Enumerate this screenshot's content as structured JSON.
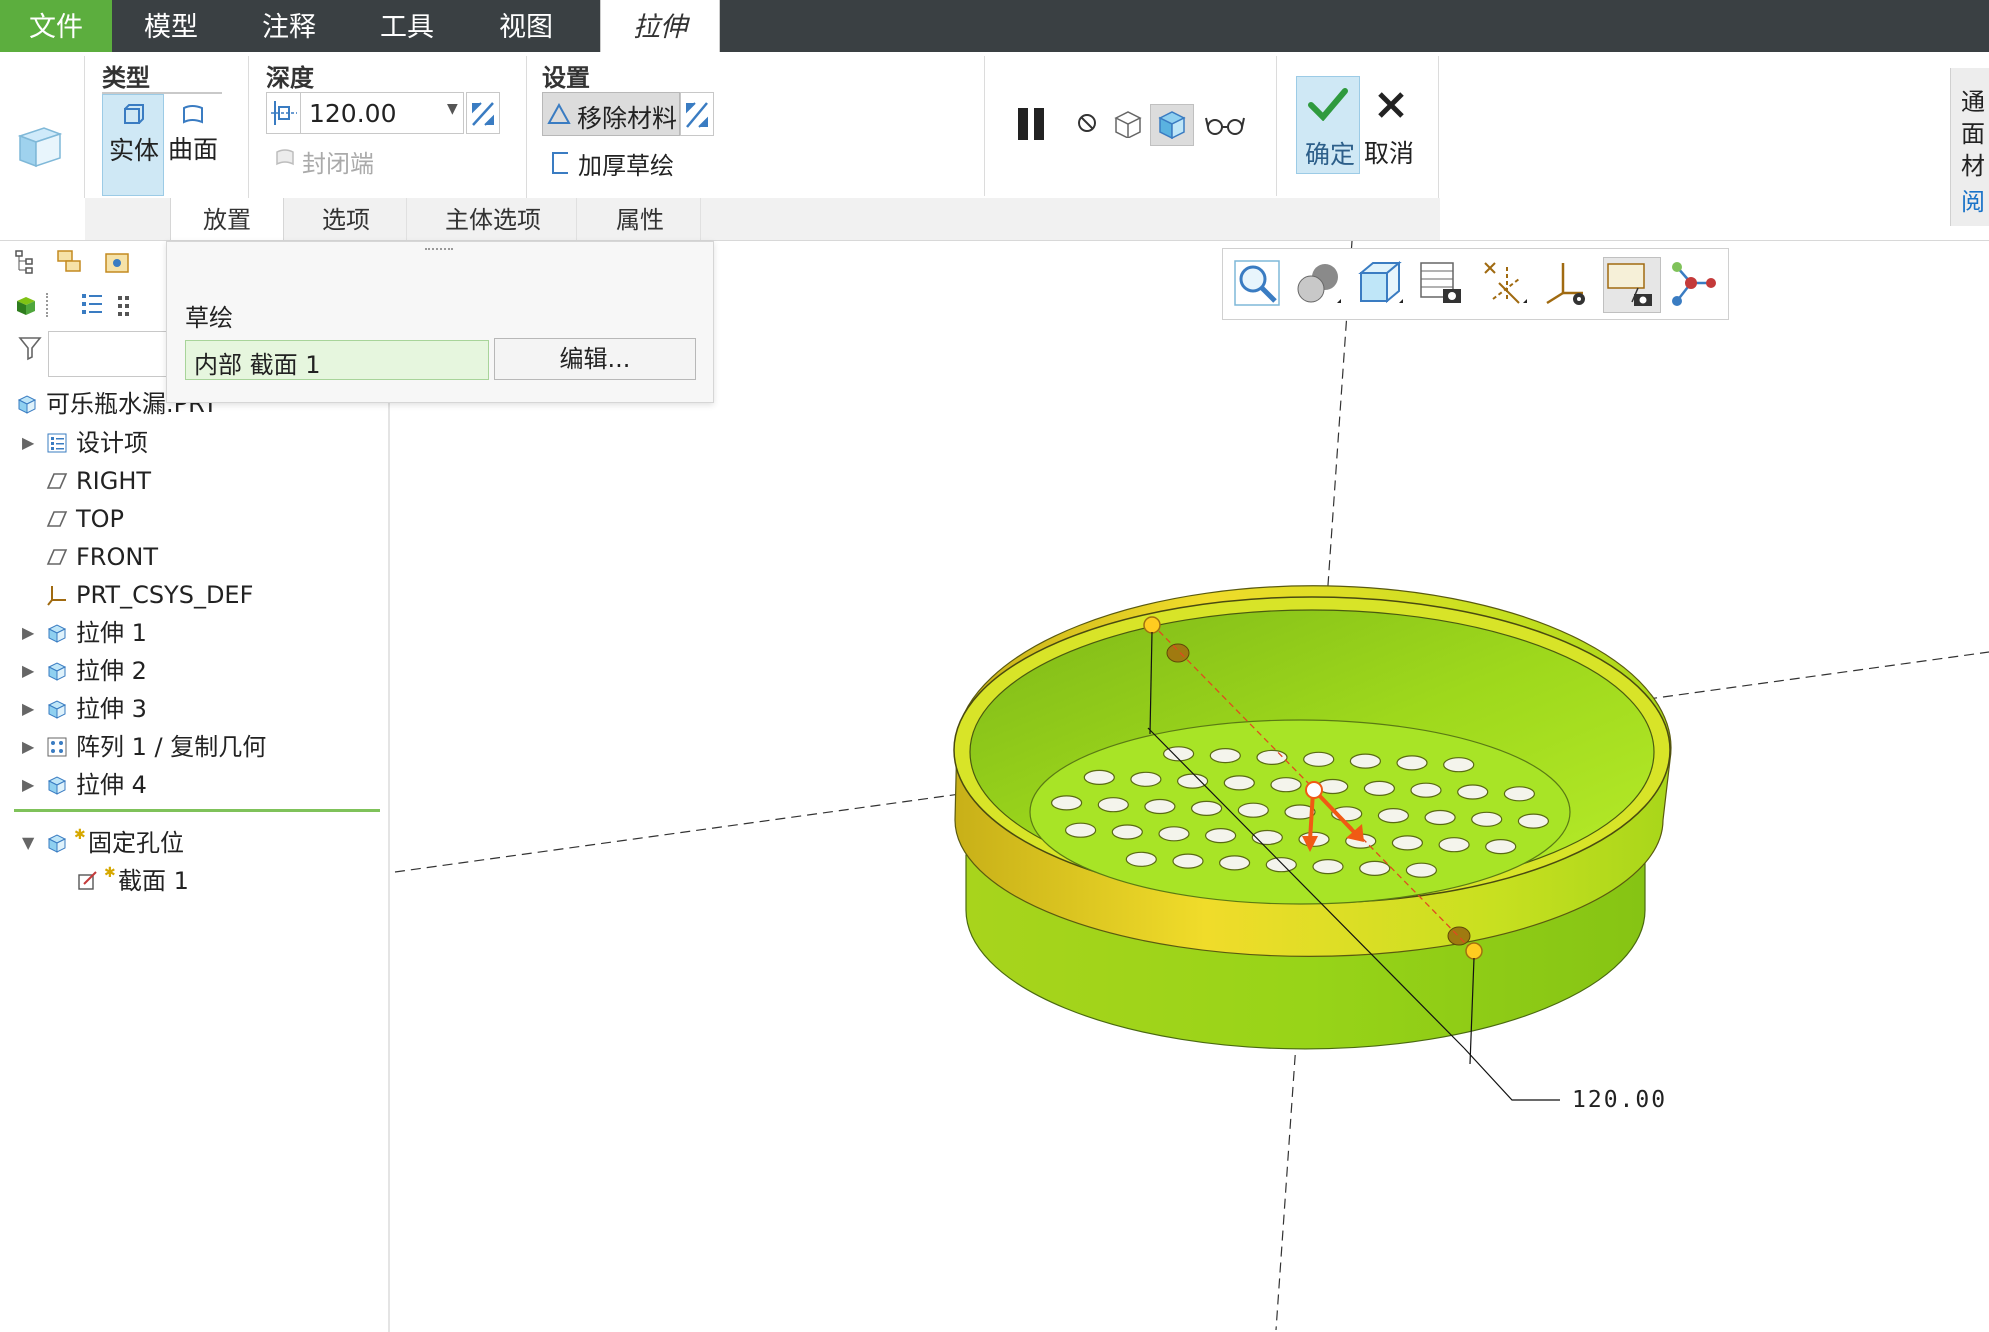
{
  "menubar": {
    "items": [
      "文件",
      "模型",
      "注释",
      "工具",
      "视图",
      "拉伸"
    ]
  },
  "ribbon": {
    "type_group": {
      "title": "类型",
      "solid": "实体",
      "surface": "曲面"
    },
    "depth_group": {
      "title": "深度",
      "value": "120.00",
      "capped_ends": "封闭端"
    },
    "settings_group": {
      "title": "设置",
      "remove_material": "移除材料",
      "thicken_sketch": "加厚草绘"
    },
    "ok_label": "确定",
    "cancel_label": "取消",
    "right_side": {
      "line1": "通",
      "line2": "面",
      "line3": "材",
      "link": "阅"
    }
  },
  "subtabs": [
    "放置",
    "选项",
    "主体选项",
    "属性"
  ],
  "placement_panel": {
    "sketch_label": "草绘",
    "sketch_value": "内部 截面 1",
    "edit_button": "编辑..."
  },
  "tree": {
    "root": "可乐瓶水漏.PRT",
    "items": [
      {
        "label": "设计项",
        "expandable": true,
        "icon": "design-items-icon"
      },
      {
        "label": "RIGHT",
        "expandable": false,
        "icon": "datum-plane-icon"
      },
      {
        "label": "TOP",
        "expandable": false,
        "icon": "datum-plane-icon"
      },
      {
        "label": "FRONT",
        "expandable": false,
        "icon": "datum-plane-icon"
      },
      {
        "label": "PRT_CSYS_DEF",
        "expandable": false,
        "icon": "csys-icon"
      },
      {
        "label": "拉伸 1",
        "expandable": true,
        "icon": "extrude-icon"
      },
      {
        "label": "拉伸 2",
        "expandable": true,
        "icon": "extrude-icon"
      },
      {
        "label": "拉伸 3",
        "expandable": true,
        "icon": "extrude-icon"
      },
      {
        "label": "阵列 1 / 复制几何",
        "expandable": true,
        "icon": "pattern-icon"
      },
      {
        "label": "拉伸 4",
        "expandable": true,
        "icon": "extrude-icon"
      }
    ],
    "active_feature": "固定孔位",
    "active_child": "截面 1"
  },
  "viewport": {
    "dimension_label": "120.00",
    "model_colors": {
      "yellow": "#e8d020",
      "green": "#9ee01a",
      "dark_green": "#7fc214"
    }
  },
  "colors": {
    "menubar_bg": "#3a4043",
    "file_tab": "#5cae3e",
    "accent_blue": "#cfe8f5",
    "ok_green": "#3a9a3a"
  }
}
